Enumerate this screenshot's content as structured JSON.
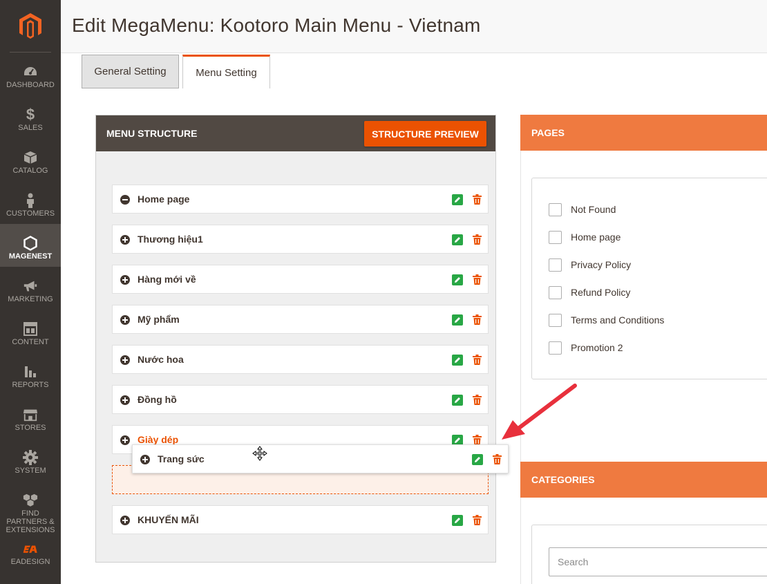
{
  "page": {
    "title": "Edit MegaMenu: Kootoro Main Menu - Vietnam"
  },
  "sidebar": {
    "items": [
      {
        "label": "DASHBOARD",
        "icon": "dashboard-icon"
      },
      {
        "label": "SALES",
        "icon": "dollar-icon"
      },
      {
        "label": "CATALOG",
        "icon": "box-icon"
      },
      {
        "label": "CUSTOMERS",
        "icon": "person-icon"
      },
      {
        "label": "MAGENEST",
        "icon": "hexagon-icon",
        "active": true
      },
      {
        "label": "MARKETING",
        "icon": "megaphone-icon"
      },
      {
        "label": "CONTENT",
        "icon": "layout-icon"
      },
      {
        "label": "REPORTS",
        "icon": "bar-chart-icon"
      },
      {
        "label": "STORES",
        "icon": "store-icon"
      },
      {
        "label": "SYSTEM",
        "icon": "gear-icon"
      },
      {
        "label": "FIND PARTNERS & EXTENSIONS",
        "icon": "cubes-icon"
      },
      {
        "label": "EADESIGN",
        "icon": "eadesign-logo-icon"
      }
    ]
  },
  "tabs": [
    {
      "label": "General Setting",
      "active": false
    },
    {
      "label": "Menu Setting",
      "active": true
    }
  ],
  "menu_structure": {
    "title": "MENU STRUCTURE",
    "preview_button": "STRUCTURE PREVIEW",
    "items": [
      {
        "label": "Home page",
        "expanded": true
      },
      {
        "label": "Thương hiệu1",
        "expanded": false
      },
      {
        "label": "Hàng mới về",
        "expanded": false
      },
      {
        "label": "Mỹ phẩm",
        "expanded": false
      },
      {
        "label": "Nước hoa",
        "expanded": false
      },
      {
        "label": "Đồng hồ",
        "expanded": false
      },
      {
        "label": "Giày dép",
        "expanded": false,
        "highlight": true
      },
      {
        "label": "KHUYẾN MÃI",
        "expanded": false
      }
    ],
    "dragging_item": {
      "label": "Trang sức"
    }
  },
  "pages_panel": {
    "title": "PAGES",
    "items": [
      {
        "label": "Not Found",
        "checked": false
      },
      {
        "label": "Home page",
        "checked": false
      },
      {
        "label": "Privacy Policy",
        "checked": false
      },
      {
        "label": "Refund Policy",
        "checked": false
      },
      {
        "label": "Terms and Conditions",
        "checked": false
      },
      {
        "label": "Promotion 2",
        "checked": false
      }
    ]
  },
  "categories_panel": {
    "title": "CATEGORIES",
    "search_placeholder": "Search"
  },
  "colors": {
    "accent": "#eb5202",
    "panel_orange": "#ef7a40",
    "sidebar_bg": "#373330",
    "edit_green": "#28a745"
  }
}
